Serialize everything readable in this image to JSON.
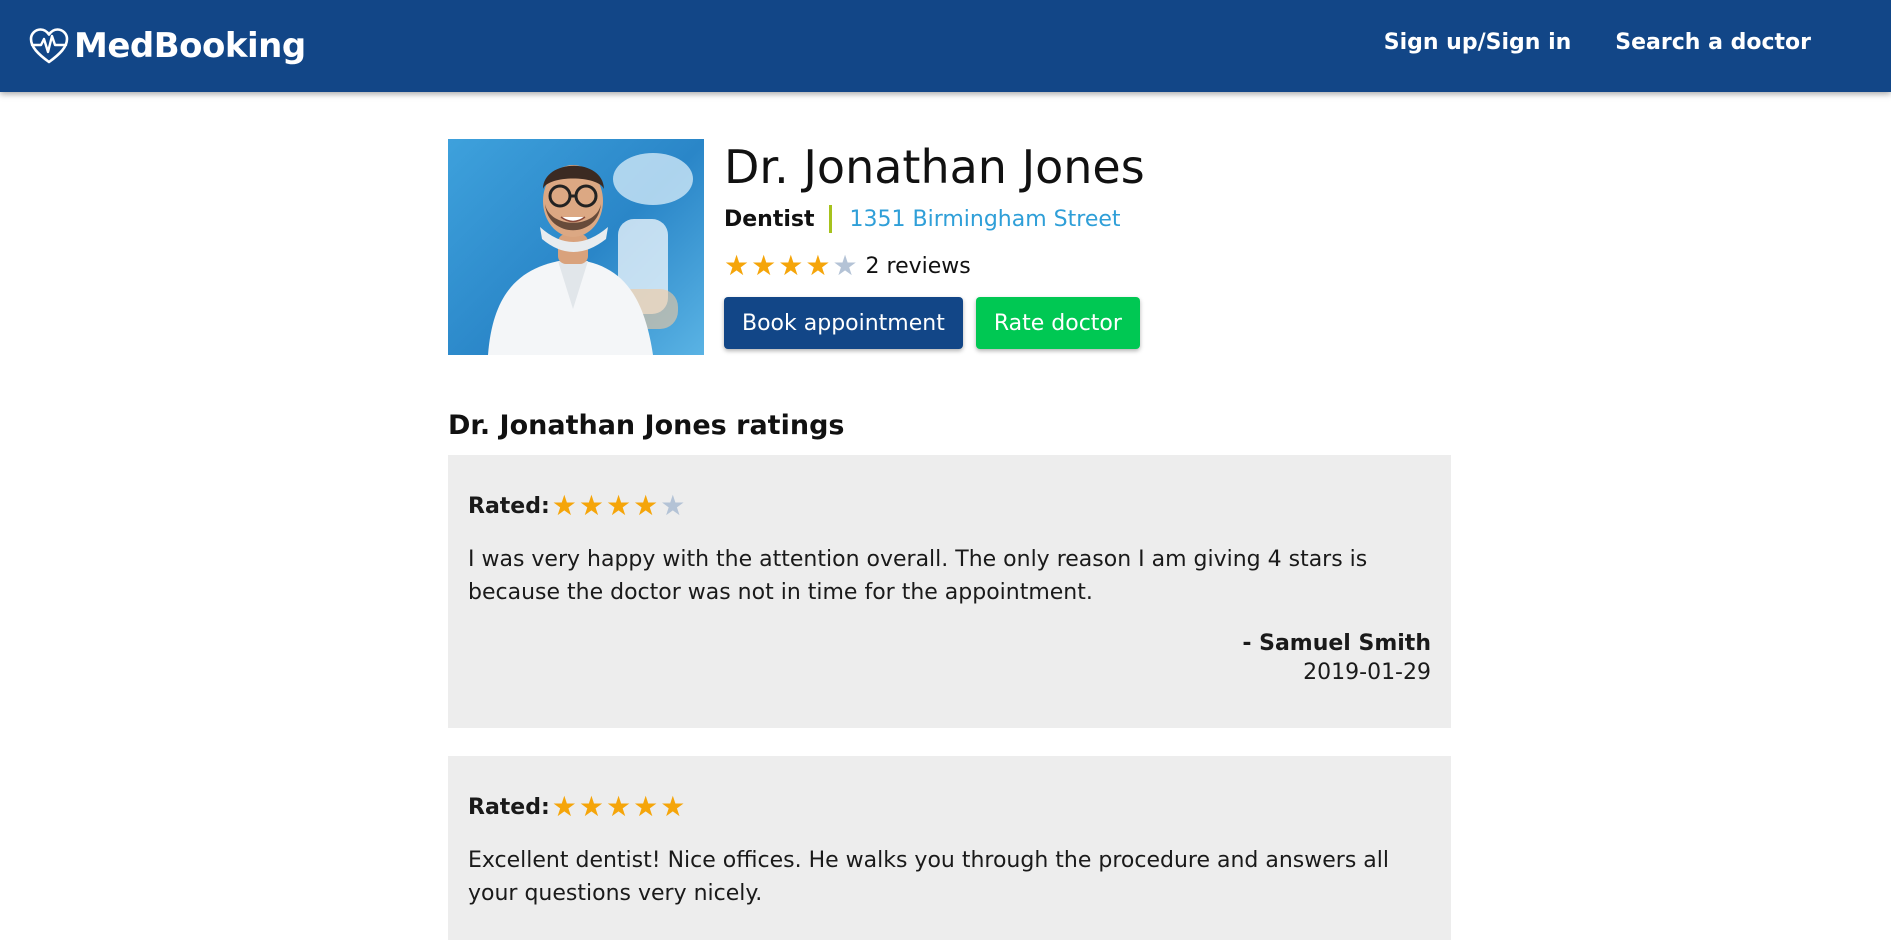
{
  "header": {
    "brand": "MedBooking",
    "nav": {
      "signin": "Sign up/Sign in",
      "search": "Search a doctor"
    },
    "color": "#124687"
  },
  "doctor": {
    "name": "Dr. Jonathan Jones",
    "specialty": "Dentist",
    "address": "1351 Birmingham Street",
    "rating": 4,
    "max_rating": 5,
    "reviews_count": "2 reviews",
    "photo_icon": "doctor-photo",
    "buttons": {
      "book": "Book appointment",
      "rate": "Rate doctor"
    }
  },
  "ratings_section": {
    "name": "Dr. Jonathan Jones",
    "suffix": " ratings"
  },
  "reviews": [
    {
      "rated_label": "Rated:",
      "stars": 4,
      "text": "I was very happy with the attention overall. The only reason I am giving 4 stars is because the doctor was not in time for the appointment.",
      "author": "- Samuel Smith",
      "date": "2019-01-29"
    },
    {
      "rated_label": "Rated:",
      "stars": 5,
      "text": "Excellent dentist! Nice offices. He walks you through the procedure and answers all your questions very nicely."
    }
  ],
  "colors": {
    "star_on": "#f5a50a",
    "star_off": "#b4c3d6",
    "book_button": "#124687",
    "rate_button": "#00c853",
    "specialty_separator": "#a6c21d",
    "address_link": "#2f9fd8"
  }
}
